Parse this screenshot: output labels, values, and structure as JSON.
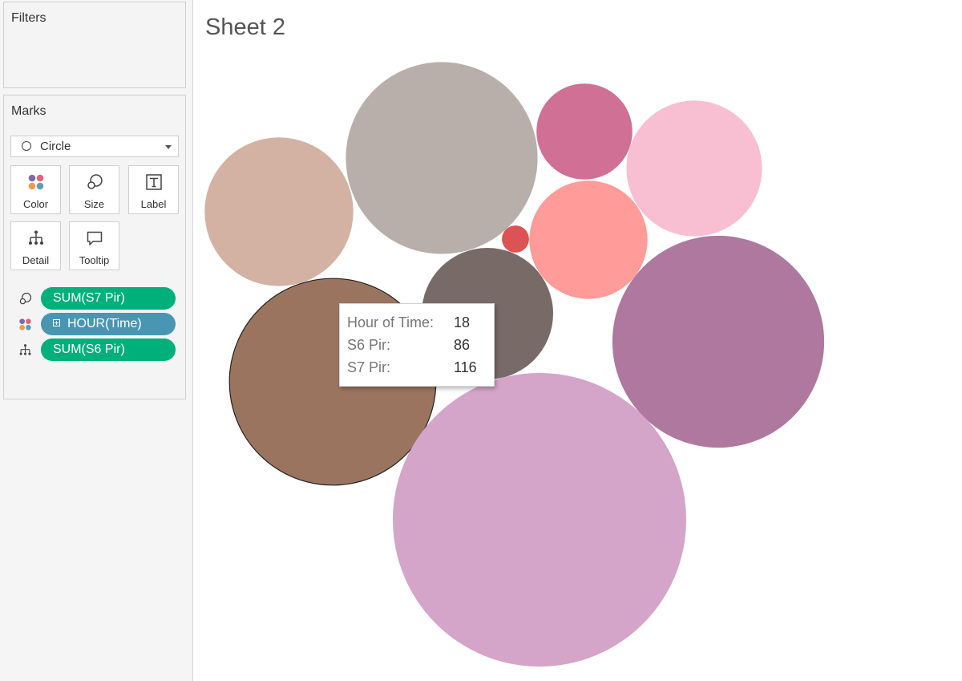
{
  "panes": {
    "filters_title": "Filters",
    "marks_title": "Marks",
    "mark_type": "Circle",
    "buttons": {
      "color": "Color",
      "size": "Size",
      "label": "Label",
      "detail": "Detail",
      "tooltip": "Tooltip"
    },
    "pills": [
      {
        "role": "size",
        "label": "SUM(S7 Pir)",
        "color": "#00b07b"
      },
      {
        "role": "color",
        "label": "HOUR(Time)",
        "color": "#4996b2"
      },
      {
        "role": "detail",
        "label": "SUM(S6 Pir)",
        "color": "#00b07b"
      }
    ]
  },
  "sheet": {
    "title": "Sheet 2"
  },
  "chart_data": {
    "type": "bubble",
    "size_measure": "SUM(S7 Pir)",
    "color_dimension": "HOUR(Time)",
    "detail_measure": "SUM(S6 Pir)",
    "bubbles": [
      {
        "color": "#d3b2a4",
        "size": 60
      },
      {
        "color": "#b8afaa",
        "size": 100
      },
      {
        "color": "#d07094",
        "size": 25
      },
      {
        "color": "#f8bfd2",
        "size": 50
      },
      {
        "color": "#ff9b98",
        "size": 38
      },
      {
        "color": "#dd5353",
        "size": 2
      },
      {
        "color": "#786a66",
        "size": 47
      },
      {
        "color": "#9b7460",
        "size": 116,
        "hour": 18,
        "s6": 86,
        "selected": true
      },
      {
        "color": "#af789e",
        "size": 122
      },
      {
        "color": "#d4a5c8",
        "size": 234
      }
    ]
  },
  "tooltip": {
    "rows": [
      {
        "key": "Hour of Time:",
        "value": "18"
      },
      {
        "key": "S6 Pir:",
        "value": "86"
      },
      {
        "key": "S7 Pir:",
        "value": "116"
      }
    ]
  }
}
